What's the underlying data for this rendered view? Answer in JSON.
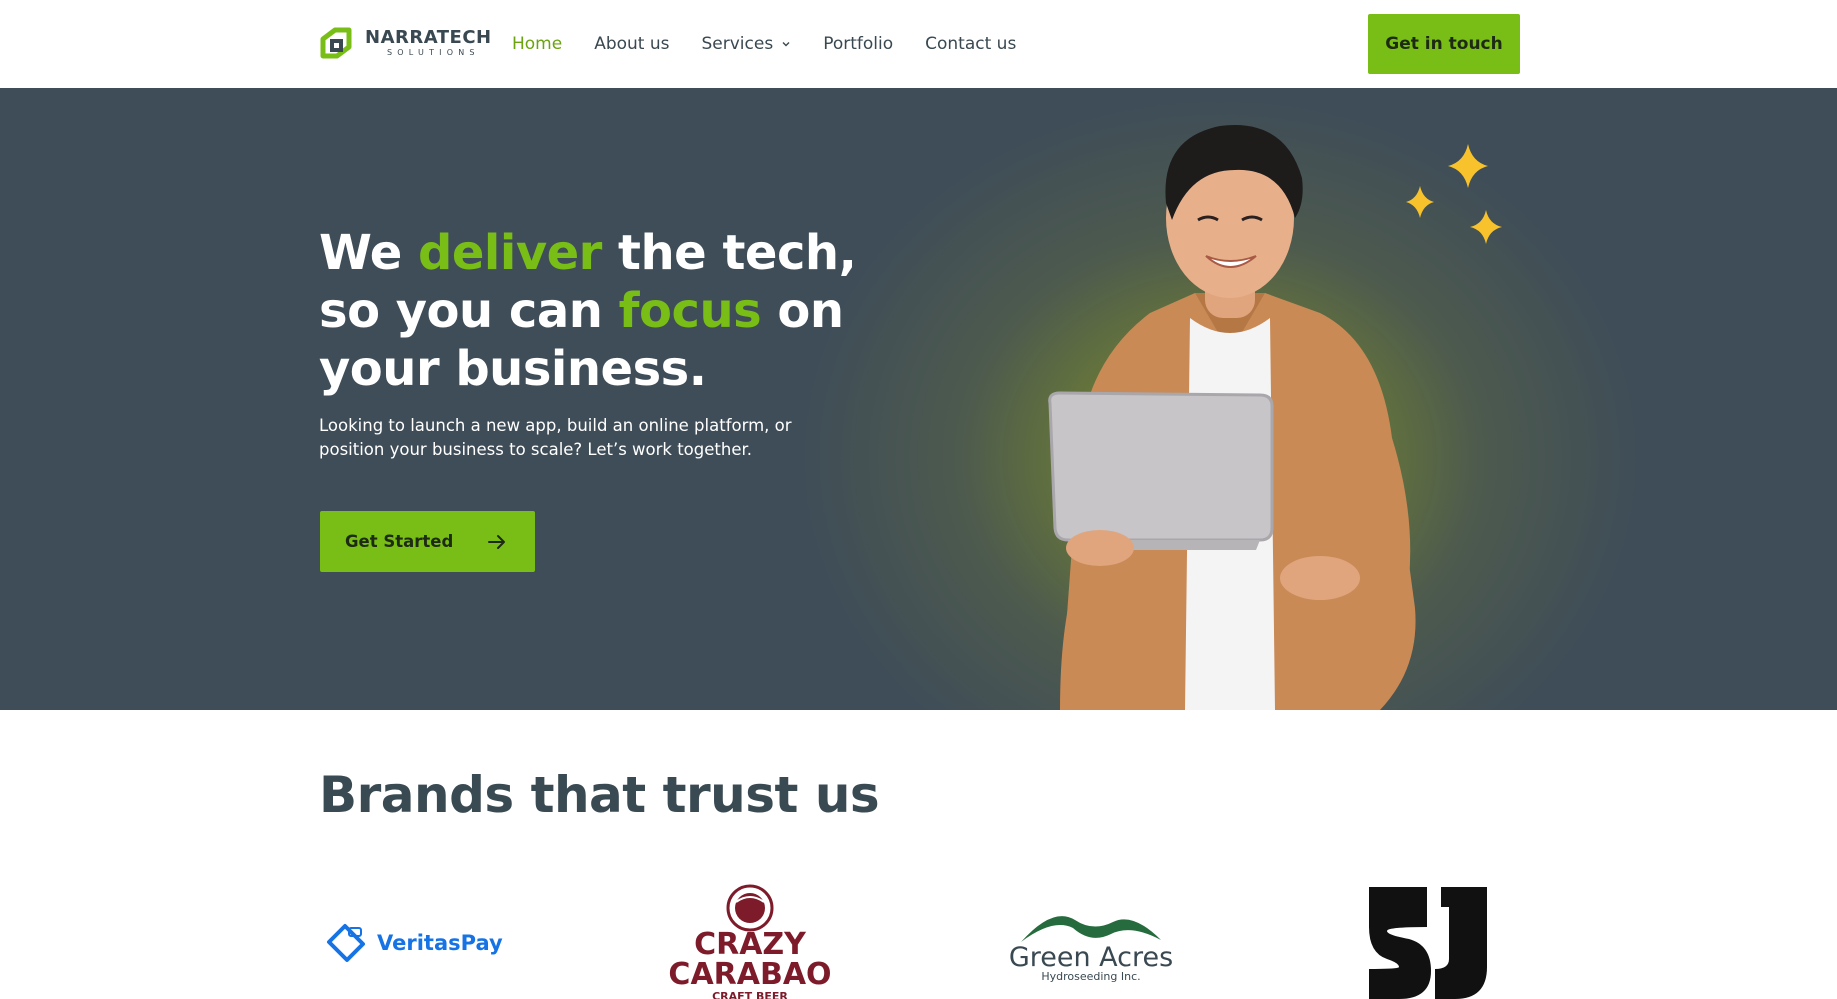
{
  "header": {
    "logo": {
      "name": "NARRATECH",
      "sub": "SOLUTIONS"
    },
    "nav": [
      {
        "label": "Home",
        "active": true
      },
      {
        "label": "About us"
      },
      {
        "label": "Services",
        "has_dropdown": true
      },
      {
        "label": "Portfolio"
      },
      {
        "label": "Contact us"
      }
    ],
    "cta_label": "Get in touch"
  },
  "hero": {
    "title_parts": {
      "p1": "We ",
      "h1": "deliver",
      "p2": " the tech, so you can ",
      "h2": "focus",
      "p3": " on your business."
    },
    "subtitle": "Looking to launch a new app, build an online platform, or position your business to scale? Let’s work together.",
    "button_label": "Get Started"
  },
  "brands": {
    "title": "Brands that trust us",
    "items": [
      {
        "name": "VeritasPay"
      },
      {
        "name": "CRAZY",
        "line2": "CARABAO",
        "line3": "CRAFT BEER"
      },
      {
        "name": "Green Acres",
        "sub": "Hydroseeding Inc."
      },
      {
        "name": "SJ"
      }
    ]
  },
  "colors": {
    "accent": "#79be16",
    "nav_active": "#6aa30f",
    "text": "#394851",
    "hero_bg": "#3f4d58",
    "veritas_blue": "#1673e6",
    "carabao_red": "#7d1b2a",
    "green_acres": "#256b3d",
    "sparkle": "#f7c22b"
  }
}
